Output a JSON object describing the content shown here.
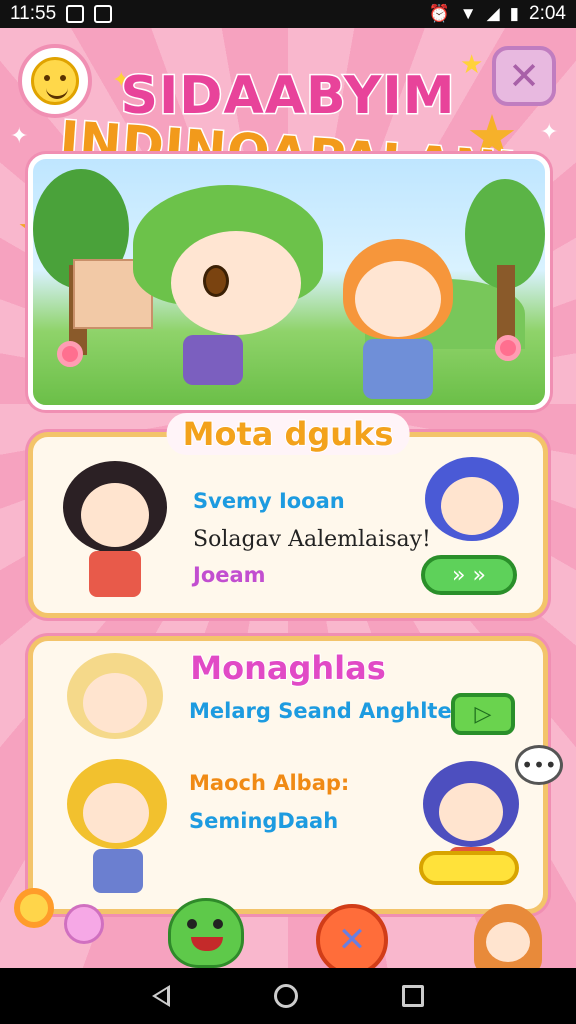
{
  "status_bar": {
    "time": "11:55",
    "clock": "2:04",
    "icons": [
      "image-icon",
      "notification-icon",
      "alarm-icon",
      "wifi-icon",
      "signal-icon",
      "battery-icon"
    ]
  },
  "title": {
    "line1": "SIDAABYIM",
    "line2": "INDINOAPALANI"
  },
  "panel1": {
    "header": "Mota dguks",
    "line1": "Svemy Iooan",
    "line2": "Solagav Aalemlaisay!",
    "line3": "Joeam",
    "button": "» »"
  },
  "panel2": {
    "header": "Monaghlas",
    "row1": "Melarg Seand Anghlten:",
    "row1_button": "▷",
    "row2_title": "Maoch Albap:",
    "row2_sub": "SemingDaah",
    "bubble": "•••"
  },
  "colors": {
    "background_pink": "#f7a9c4",
    "panel_border": "#f3c46a",
    "accent_green": "#5ed15a",
    "accent_yellow": "#ffe23a"
  }
}
